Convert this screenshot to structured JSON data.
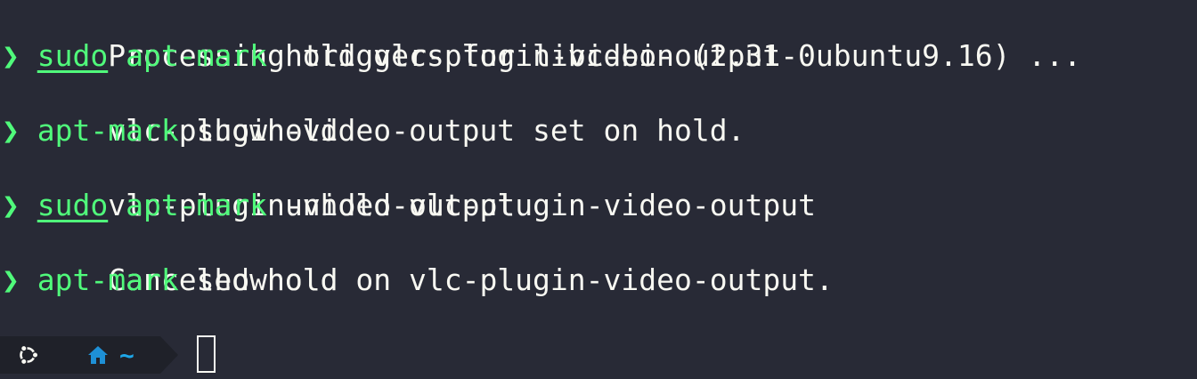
{
  "terminal": {
    "lines": [
      {
        "type": "output",
        "text": "Processing triggers for libc-bin (2.31-0ubuntu9.16) ..."
      },
      {
        "type": "command",
        "prompt": "❯",
        "sudo": "sudo",
        "command": "apt-mark",
        "args": "hold vlc-plugin-video-output"
      },
      {
        "type": "output",
        "text": "vlc-plugin-video-output set on hold."
      },
      {
        "type": "command",
        "prompt": "❯",
        "sudo": "",
        "command": "apt-mark",
        "args": "showhold"
      },
      {
        "type": "output",
        "text": "vlc-plugin-video-output"
      },
      {
        "type": "command",
        "prompt": "❯",
        "sudo": "sudo",
        "command": "apt-mark",
        "args": "unhold vlc-plugin-video-output"
      },
      {
        "type": "output",
        "text": "Canceled hold on vlc-plugin-video-output."
      },
      {
        "type": "command",
        "prompt": "❯",
        "sudo": "",
        "command": "apt-mark",
        "args": "showhold"
      }
    ],
    "prompt_bar": {
      "os_icon": "ubuntu-icon",
      "dir_icon": "home-icon",
      "dir_text": "~"
    }
  },
  "colors": {
    "background": "#282a36",
    "foreground": "#f8f8f2",
    "command": "#50fa7b",
    "path": "#1ea7e8",
    "segment_bg": "#1f2129"
  }
}
